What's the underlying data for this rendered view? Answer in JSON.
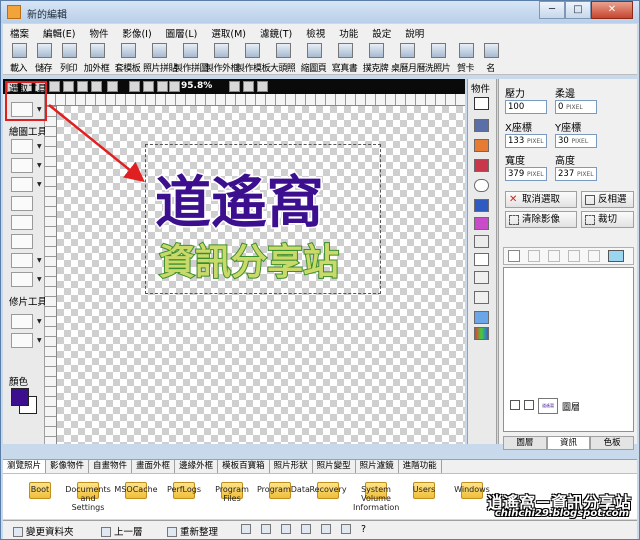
{
  "window": {
    "title": "新的編輯",
    "minimize": "─",
    "maximize": "□",
    "close": "✕"
  },
  "menu": [
    "檔案",
    "編輯(E)",
    "物件",
    "影像(I)",
    "圖層(L)",
    "選取(M)",
    "濾鏡(T)",
    "檢視",
    "功能",
    "設定",
    "說明"
  ],
  "toolbar": [
    "載入",
    "儲存",
    "列印",
    "加外框",
    "套模板",
    "照片拼貼",
    "製作拼圖",
    "製作外框",
    "製作模板",
    "大頭照",
    "縮圖頁",
    "寫真書",
    "撲克牌",
    "桌曆月曆",
    "洗照片",
    "賀卡",
    "名"
  ],
  "canvas_toolbar": {
    "zoom": "95.8%"
  },
  "left_panel": {
    "select_tools_label": "選取工具",
    "paint_tools_label": "繪圖工具",
    "retouch_tools_label": "修片工具",
    "color_label": "顏色",
    "foreground_color": "#3c0f8f",
    "background_color": "#ffffff"
  },
  "canvas": {
    "logo_title": "道遙窩",
    "logo_subtitle": "資訊分享站"
  },
  "object_panel": {
    "label": "物件"
  },
  "properties": {
    "opacity_label": "壓力",
    "opacity_value": "100",
    "feather_label": "柔邊",
    "feather_value": "0",
    "x_label": "X座標",
    "x_value": "133",
    "y_label": "Y座標",
    "y_value": "30",
    "width_label": "寬度",
    "width_value": "379",
    "height_label": "高度",
    "height_value": "237",
    "unit": "PIXEL",
    "cancel_select_button": "取消選取",
    "invert_select_button": "反相選",
    "clear_image_button": "清除影像",
    "crop_button": "裁切",
    "layer_thumb_text": "道遙窩",
    "layer_name": "圖層",
    "tabs": [
      "圖層",
      "資訊",
      "色板"
    ]
  },
  "bottom_tabs": [
    "瀏覽照片",
    "影像物件",
    "自畫物件",
    "畫面外框",
    "邊緣外框",
    "模板百寶箱",
    "照片形狀",
    "照片變型",
    "照片濾鏡",
    "進階功能"
  ],
  "folders": [
    "Boot",
    "Documents and Settings",
    "MSOCache",
    "PerfLogs",
    "Program Files",
    "ProgramData",
    "Recovery",
    "System Volume Information",
    "Users",
    "Windows"
  ],
  "statusbar": {
    "change_folder": "變更資料夾",
    "up_level": "上一層",
    "refresh": "重新整理",
    "help": "?"
  },
  "watermark": {
    "title": "逍遙窩－資訊分享站",
    "url": "chihchi29.blogspot.com"
  },
  "colors": {
    "annotation": "#e02020",
    "logo_purple": "#3c0f8f",
    "logo_maroon": "#5a0f14"
  }
}
